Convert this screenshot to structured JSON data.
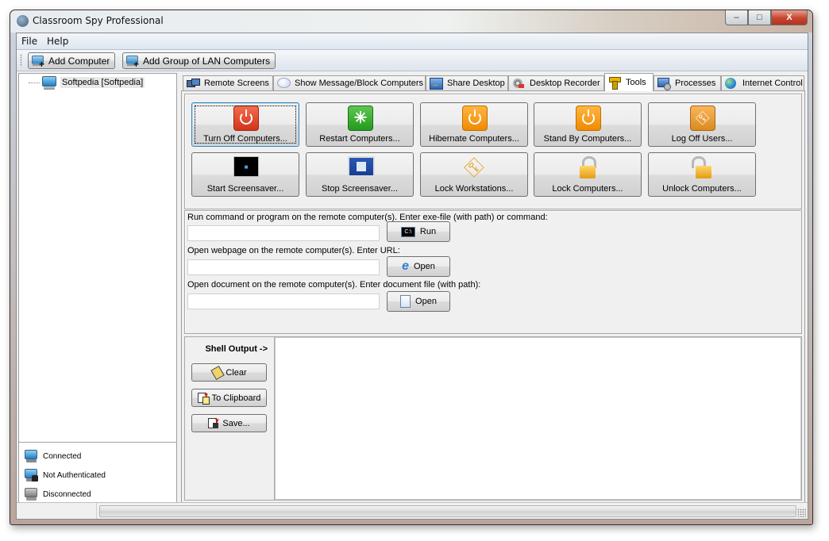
{
  "window": {
    "title": "Classroom Spy Professional",
    "controls": {
      "minimize": "–",
      "maximize": "□",
      "close": "X"
    }
  },
  "menu": {
    "items": [
      "File",
      "Help"
    ]
  },
  "toolbar": {
    "add_computer": "Add Computer",
    "add_group": "Add Group of LAN Computers"
  },
  "tree": {
    "items": [
      {
        "label": "Softpedia [Softpedia]",
        "icon": "computer-connected-icon"
      }
    ]
  },
  "legend": {
    "items": [
      {
        "label": "Connected",
        "icon": "computer-connected-icon",
        "color": "#2b87c9"
      },
      {
        "label": "Not Authenticated",
        "icon": "computer-locked-icon",
        "color": "#2b87c9"
      },
      {
        "label": "Disconnected",
        "icon": "computer-disconnected-icon",
        "color": "#8a8a8a"
      }
    ]
  },
  "tabs": [
    {
      "label": "Remote Screens",
      "icon": "monitors-icon",
      "active": false
    },
    {
      "label": "Show Message/Block Computers",
      "icon": "speech-bubble-icon",
      "active": false
    },
    {
      "label": "Share Desktop",
      "icon": "share-desktop-icon",
      "active": false
    },
    {
      "label": "Desktop Recorder",
      "icon": "film-reel-icon",
      "active": false
    },
    {
      "label": "Tools",
      "icon": "drill-icon",
      "active": true
    },
    {
      "label": "Processes",
      "icon": "processes-icon",
      "active": false
    },
    {
      "label": "Internet Control",
      "icon": "globe-icon",
      "active": false
    }
  ],
  "tools": {
    "buttons": [
      {
        "label": "Turn Off Computers...",
        "icon": "power-red-icon",
        "focused": true
      },
      {
        "label": "Restart Computers...",
        "icon": "restart-green-icon"
      },
      {
        "label": "Hibernate Computers...",
        "icon": "power-orange-icon"
      },
      {
        "label": "Stand By Computers...",
        "icon": "standby-orange-icon"
      },
      {
        "label": "Log Off Users...",
        "icon": "key-orange-icon"
      },
      {
        "label": "Start Screensaver...",
        "icon": "screensaver-start-icon"
      },
      {
        "label": "Stop Screensaver...",
        "icon": "screensaver-stop-icon"
      },
      {
        "label": "Lock Workstations...",
        "icon": "key-icon"
      },
      {
        "label": "Lock Computers...",
        "icon": "padlock-closed-icon"
      },
      {
        "label": "Unlock Computers...",
        "icon": "padlock-open-icon"
      }
    ]
  },
  "commands": {
    "run": {
      "label": "Run command or program on the remote computer(s). Enter exe-file (with path) or command:",
      "value": "",
      "button": "Run",
      "button_icon": "C:\\"
    },
    "webpage": {
      "label": "Open webpage on the remote computer(s). Enter URL:",
      "value": "",
      "button": "Open"
    },
    "document": {
      "label": "Open document on the remote computer(s). Enter document file (with path):",
      "value": "",
      "button": "Open"
    }
  },
  "shell": {
    "title": "Shell Output ->",
    "clear": "Clear",
    "clipboard": "To Clipboard",
    "save": "Save...",
    "output": ""
  },
  "status": {
    "text": ""
  }
}
